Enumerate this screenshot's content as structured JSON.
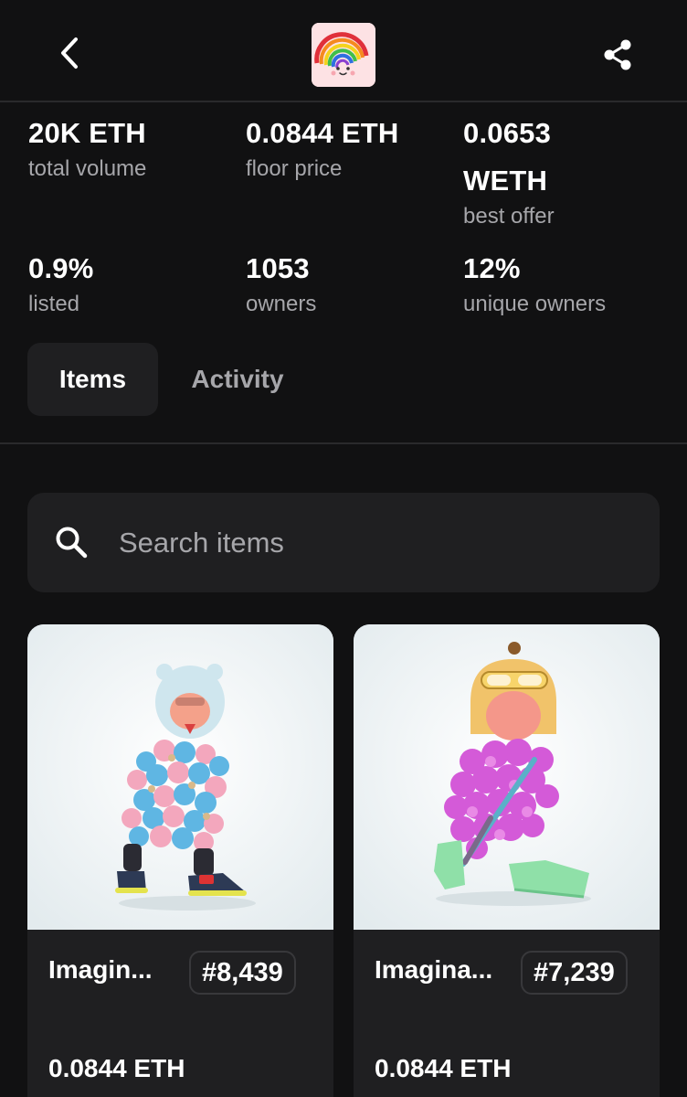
{
  "header": {
    "back_icon": "chevron-left-icon",
    "logo": "rainbow-face-logo",
    "share_icon": "share-icon"
  },
  "stats": [
    {
      "value": "20K ETH",
      "label": "total volume"
    },
    {
      "value": "0.0844 ETH",
      "label": "floor price"
    },
    {
      "value_line1": "0.0653",
      "value_line2": "WETH",
      "label": "best offer"
    },
    {
      "value": "0.9%",
      "label": "listed"
    },
    {
      "value": "1053",
      "label": "owners"
    },
    {
      "value": "12%",
      "label": "unique owners"
    }
  ],
  "tabs": [
    {
      "label": "Items",
      "active": true
    },
    {
      "label": "Activity",
      "active": false
    }
  ],
  "search": {
    "placeholder": "Search items",
    "icon": "search-icon"
  },
  "items": [
    {
      "name": "Imagin...",
      "number": "#8,439",
      "price": "0.0844 ETH"
    },
    {
      "name": "Imagina...",
      "number": "#7,239",
      "price": "0.0844 ETH"
    }
  ],
  "colors": {
    "background": "#111112",
    "surface": "#1f1f21",
    "muted_text": "#a6a6aa",
    "divider": "#2a2a2c"
  }
}
